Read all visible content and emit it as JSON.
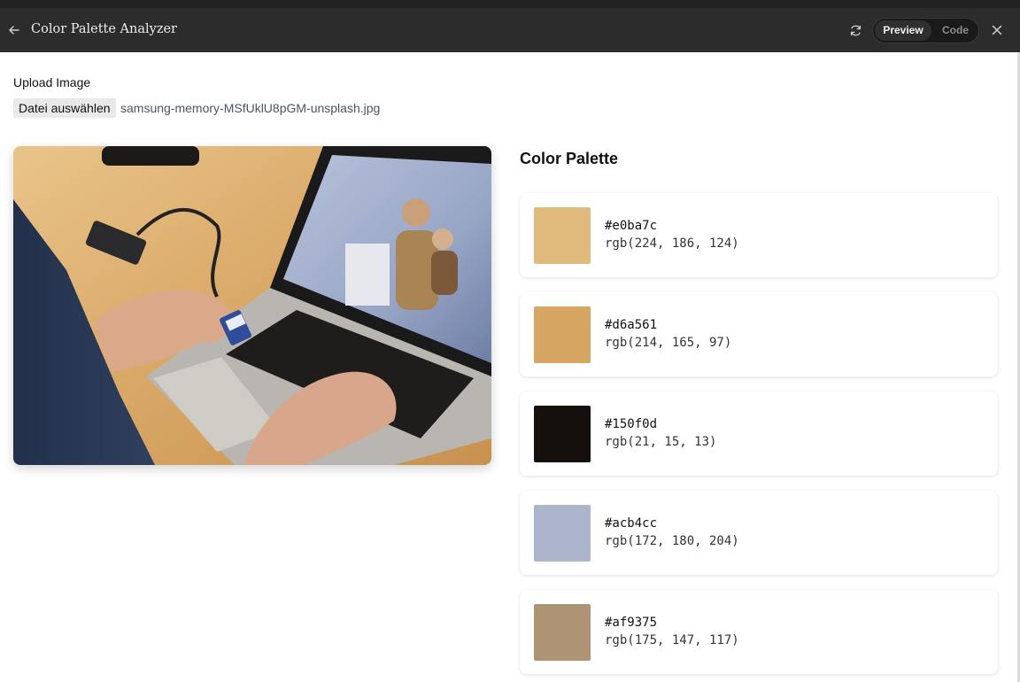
{
  "window": {
    "title": "Color Palette Analyzer",
    "view_toggle": {
      "preview": "Preview",
      "code": "Code",
      "active": "Preview"
    },
    "icons": {
      "back": "back-arrow-icon",
      "refresh": "refresh-icon",
      "close": "close-icon"
    }
  },
  "upload": {
    "label": "Upload Image",
    "button_label": "Datei auswählen",
    "file_name": "samsung-memory-MSfUklU8pGM-unsplash.jpg"
  },
  "palette": {
    "title": "Color Palette",
    "colors": [
      {
        "hex": "#e0ba7c",
        "rgb": "rgb(224, 186, 124)"
      },
      {
        "hex": "#d6a561",
        "rgb": "rgb(214, 165, 97)"
      },
      {
        "hex": "#150f0d",
        "rgb": "rgb(21, 15, 13)"
      },
      {
        "hex": "#acb4cc",
        "rgb": "rgb(172, 180, 204)"
      },
      {
        "hex": "#af9375",
        "rgb": "rgb(175, 147, 117)"
      }
    ]
  }
}
